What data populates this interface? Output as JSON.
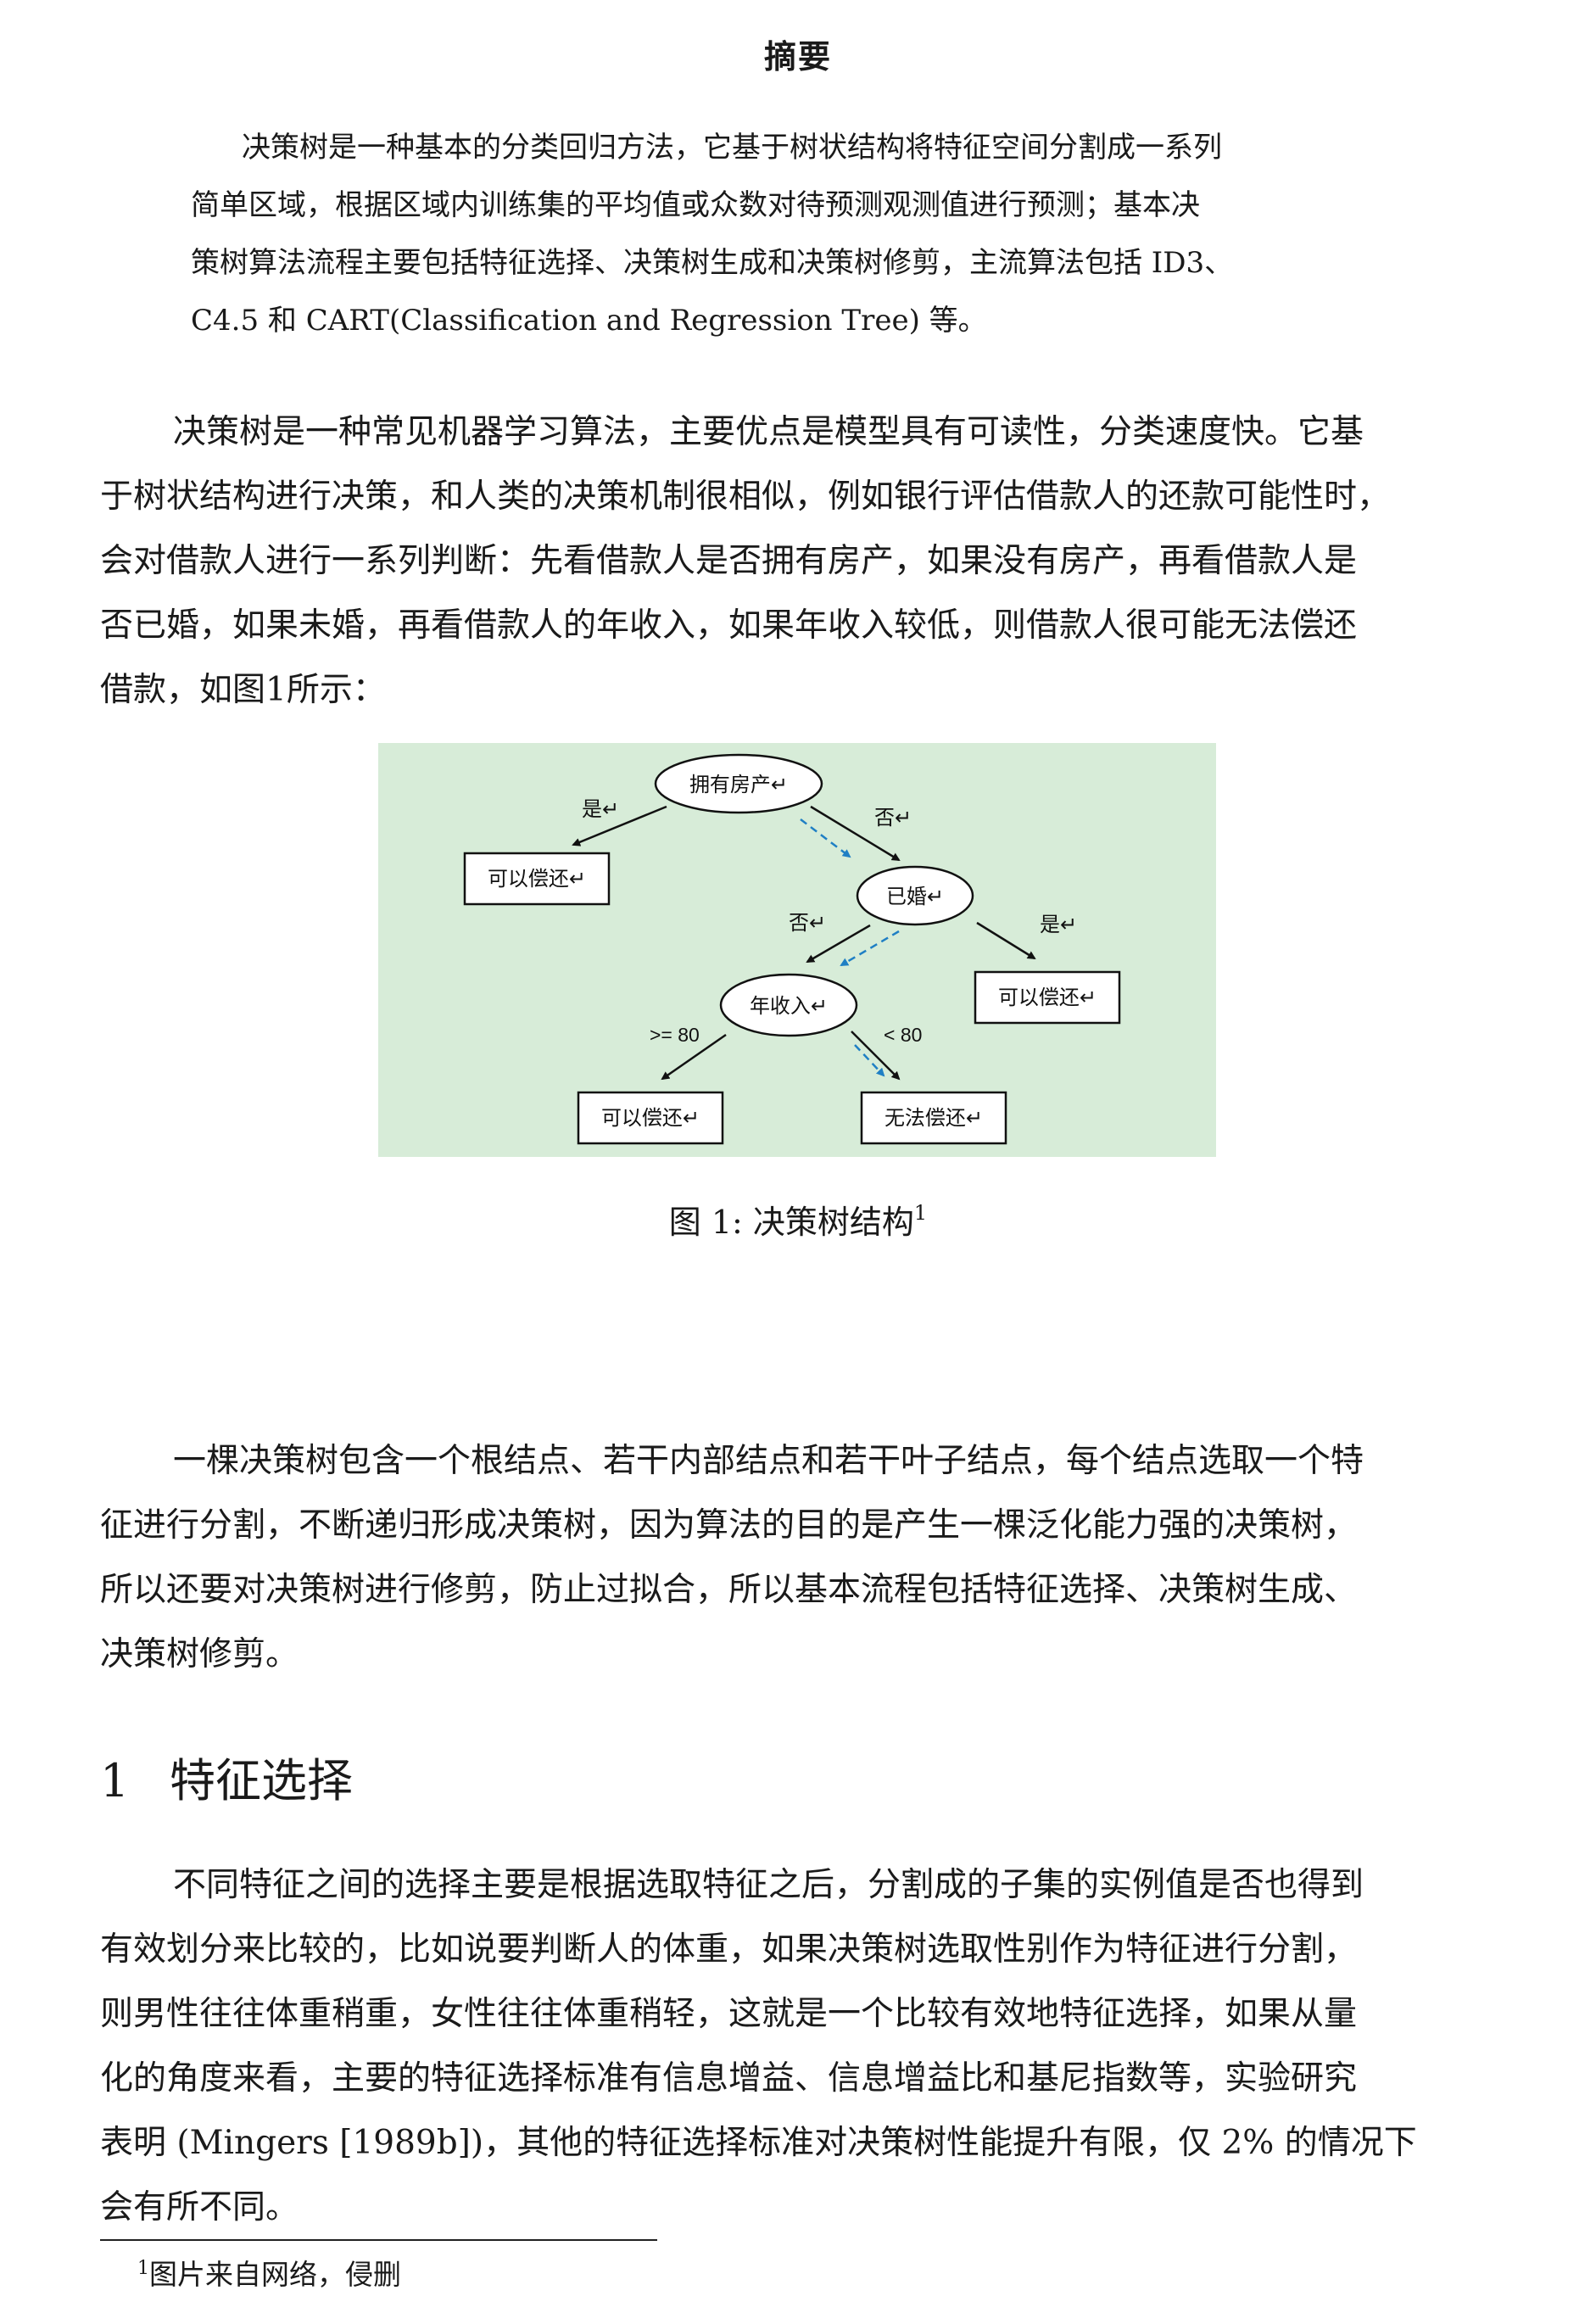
{
  "abstract": {
    "title": "摘要",
    "lines": [
      "决策树是一种基本的分类回归方法，它基于树状结构将特征空间分割成一系列",
      "简单区域，根据区域内训练集的平均值或众数对待预测观测值进行预测；基本决",
      "策树算法流程主要包括特征选择、决策树生成和决策树修剪，主流算法包括 ID3、",
      "C4.5 和 CART(Classification and Regression Tree) 等。"
    ]
  },
  "paragraphs": {
    "p1": [
      "决策树是一种常见机器学习算法，主要优点是模型具有可读性，分类速度快。它基",
      "于树状结构进行决策，和人类的决策机制很相似，例如银行评估借款人的还款可能性时，",
      "会对借款人进行一系列判断：先看借款人是否拥有房产，如果没有房产，再看借款人是",
      "否已婚，如果未婚，再看借款人的年收入，如果年收入较低，则借款人很可能无法偿还",
      "借款，如图1所示："
    ],
    "p2": [
      "一棵决策树包含一个根结点、若干内部结点和若干叶子结点，每个结点选取一个特",
      "征进行分割，不断递归形成决策树，因为算法的目的是产生一棵泛化能力强的决策树，",
      "所以还要对决策树进行修剪，防止过拟合，所以基本流程包括特征选择、决策树生成、",
      "决策树修剪。"
    ],
    "p3": [
      "不同特征之间的选择主要是根据选取特征之后，分割成的子集的实例值是否也得到",
      "有效划分来比较的，比如说要判断人的体重，如果决策树选取性别作为特征进行分割，",
      "则男性往往体重稍重，女性往往体重稍轻，这就是一个比较有效地特征选择，如果从量",
      "化的角度来看，主要的特征选择标准有信息增益、信息增益比和基尼指数等，实验研究",
      "表明 (Mingers [1989b])，其他的特征选择标准对决策树性能提升有限，仅 2% 的情况下",
      "会有所不同。"
    ]
  },
  "figure": {
    "background": "#d7ecd8",
    "nodes": {
      "root": "拥有房产↵",
      "married": "已婚↵",
      "income": "年收入↵",
      "leaf_yes1": "可以偿还↵",
      "leaf_yes2": "可以偿还↵",
      "leaf_yes3": "可以偿还↵",
      "leaf_no": "无法偿还↵"
    },
    "edges": {
      "root_yes": "是↵",
      "root_no": "否↵",
      "married_no": "否↵",
      "married_yes": "是↵",
      "income_ge": ">= 80",
      "income_lt": "< 80"
    },
    "path_color": "#1f7fc4"
  },
  "caption": {
    "text": "图 1: 决策树结构",
    "footnote_mark": "1"
  },
  "section": {
    "number": "1",
    "title": "特征选择"
  },
  "footnote": {
    "mark": "1",
    "text": "图片来自网络，侵删"
  }
}
